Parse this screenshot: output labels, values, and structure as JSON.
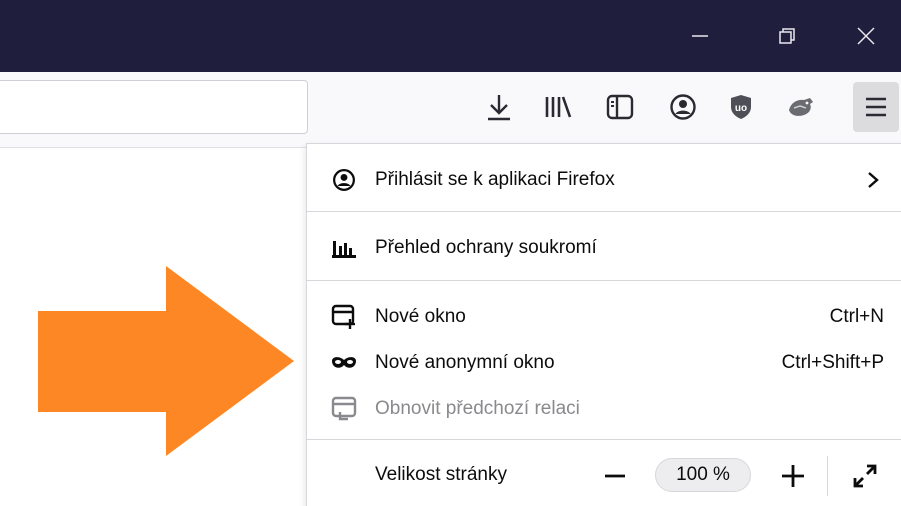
{
  "colors": {
    "titlebar": "#1f1e3d",
    "toolbar": "#f9f9fb",
    "accent_arrow": "#fd8724",
    "menu_active_button": "#dcdcdf"
  },
  "titlebar": {
    "icons": [
      "minimize-icon",
      "restore-icon",
      "close-icon"
    ]
  },
  "toolbar": {
    "icons": [
      "download-icon",
      "library-icon",
      "sidebar-icon",
      "account-icon",
      "ublock-icon",
      "extension-icon",
      "hamburger-menu-icon"
    ]
  },
  "menu": {
    "sign_in": {
      "label": "Přihlásit se k aplikaci Firefox",
      "icon": "account-icon"
    },
    "protections": {
      "label": "Přehled ochrany soukromí",
      "icon": "protections-dashboard-icon"
    },
    "new_window": {
      "label": "Nové okno",
      "shortcut": "Ctrl+N",
      "icon": "new-window-icon"
    },
    "private_window": {
      "label": "Nové anonymní okno",
      "shortcut": "Ctrl+Shift+P",
      "icon": "private-mask-icon"
    },
    "restore_session": {
      "label": "Obnovit předchozí relaci",
      "icon": "restore-session-icon",
      "disabled": true
    },
    "zoom": {
      "label": "Velikost stránky",
      "value": "100 %"
    }
  }
}
